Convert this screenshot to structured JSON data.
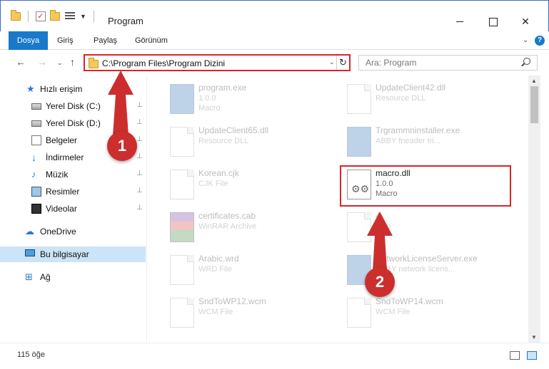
{
  "window": {
    "title": "Program",
    "controls": {
      "minimize": "",
      "maximize": "",
      "close": "✕"
    }
  },
  "ribbon": {
    "tabs": [
      "Dosya",
      "Giriş",
      "Paylaş",
      "Görünüm"
    ],
    "caret": "⌄",
    "help": "?"
  },
  "nav": {
    "back": "←",
    "forward": "→",
    "recent": "⌄",
    "up": "↑",
    "address": "C:\\Program Files\\Program Dizini",
    "address_dropdown": "⌄",
    "refresh": "↻",
    "search_placeholder": "Ara: Program"
  },
  "sidebar": {
    "items": [
      {
        "label": "Hızlı erişim",
        "icon": "star-icon",
        "pinned": false
      },
      {
        "label": "Yerel Disk (C:)",
        "icon": "disk-icon",
        "pinned": true
      },
      {
        "label": "Yerel Disk (D:)",
        "icon": "disk-icon",
        "pinned": true
      },
      {
        "label": "Belgeler",
        "icon": "documents-icon",
        "pinned": true
      },
      {
        "label": "İndirmeler",
        "icon": "downloads-icon",
        "pinned": true
      },
      {
        "label": "Müzik",
        "icon": "music-icon",
        "pinned": true
      },
      {
        "label": "Resimler",
        "icon": "pictures-icon",
        "pinned": true
      },
      {
        "label": "Videolar",
        "icon": "videos-icon",
        "pinned": true
      },
      {
        "label": "OneDrive",
        "icon": "onedrive-icon",
        "pinned": false
      },
      {
        "label": "Bu bilgisayar",
        "icon": "this-pc-icon",
        "pinned": false,
        "selected": true
      },
      {
        "label": "Ağ",
        "icon": "network-icon",
        "pinned": false
      }
    ],
    "pin_glyph": "📌"
  },
  "files": [
    {
      "name": "program.exe",
      "line2": "1.0.0",
      "line3": "Macro",
      "icon": "exe-icon",
      "faded": true
    },
    {
      "name": "UpdateClient42.dll",
      "line2": "Resource DLL",
      "line3": "",
      "icon": "file-icon",
      "faded": true
    },
    {
      "name": "UpdateClient65.dll",
      "line2": "Resource DLL",
      "line3": "",
      "icon": "file-icon",
      "faded": true
    },
    {
      "name": "Trgrammninstaller.exe",
      "line2": "ABBY fneader tri...",
      "line3": "",
      "icon": "exe-icon",
      "faded": true
    },
    {
      "name": "Korean.cjk",
      "line2": "CJK File",
      "line3": "",
      "icon": "file-icon",
      "faded": true
    },
    {
      "name": "macro.dll",
      "line2": "1.0.0",
      "line3": "Macro",
      "icon": "gear-dll-icon",
      "faded": false
    },
    {
      "name": "certificates.cab",
      "line2": "WinRAR Archive",
      "line3": "",
      "icon": "rar-icon",
      "faded": true
    },
    {
      "name": "4",
      "line2": "acro",
      "line3": "",
      "icon": "file-icon",
      "faded": true
    },
    {
      "name": "Arabic.wrd",
      "line2": "WRD File",
      "line3": "",
      "icon": "file-icon",
      "faded": true
    },
    {
      "name": "NetworkLicenseServer.exe",
      "line2": "ABBY network licens...",
      "line3": "",
      "icon": "exe-icon",
      "faded": true
    },
    {
      "name": "SndToWP12.wcm",
      "line2": "WCM File",
      "line3": "",
      "icon": "file-icon",
      "faded": true
    },
    {
      "name": "SndToWP14.wcm",
      "line2": "WCM File",
      "line3": "",
      "icon": "file-icon",
      "faded": true
    }
  ],
  "status": {
    "count": "115 öğe"
  },
  "annotations": {
    "step1": "1",
    "step2": "2",
    "color": "#cc2e2e"
  },
  "colors": {
    "accent": "#1979ca",
    "highlight": "#d8262a",
    "selected_bg": "#cce4f7"
  }
}
